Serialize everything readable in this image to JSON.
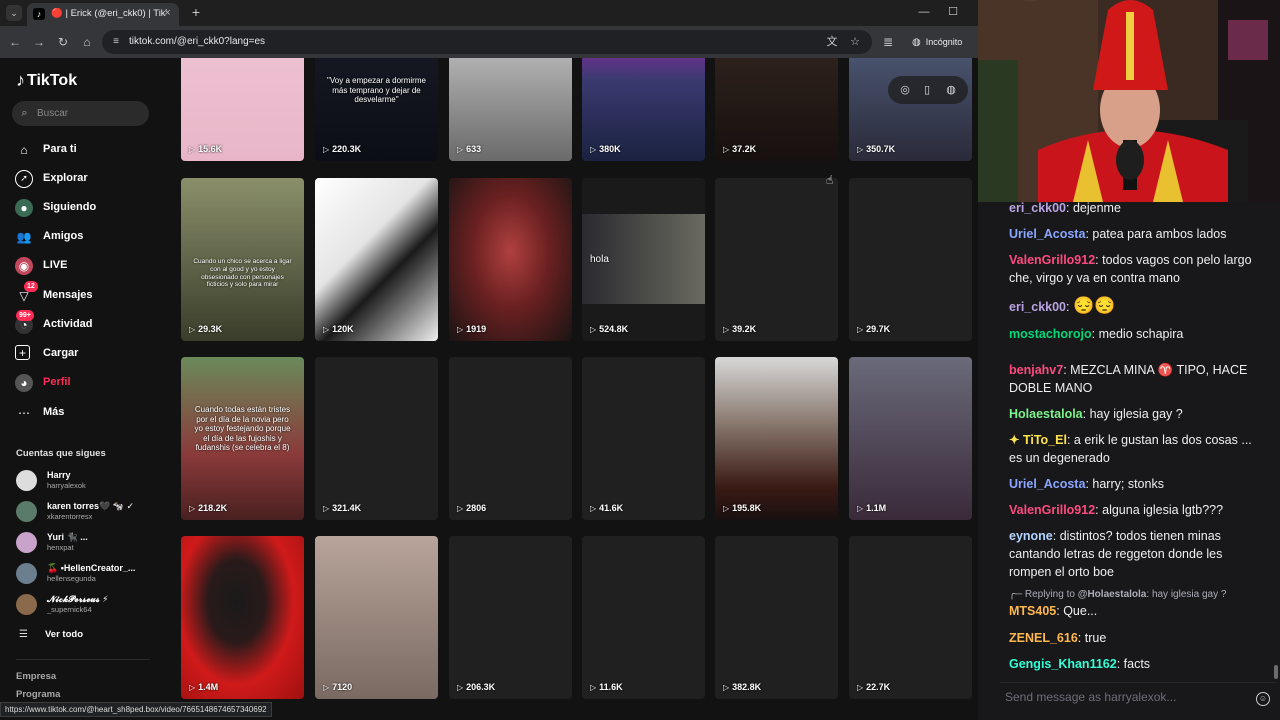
{
  "browser": {
    "tab_title": "🔴 | Erick (@eri_ckk0) | TikTok",
    "url": "tiktok.com/@eri_ckk0?lang=es",
    "incognito_label": "Incógnito",
    "status_url": "https://www.tiktok.com/@heart_sh8ped.box/video/7665148674657340692"
  },
  "sidebar": {
    "logo": "TikTok",
    "search_placeholder": "Buscar",
    "nav": [
      {
        "label": "Para ti",
        "icon": "home-icon"
      },
      {
        "label": "Explorar",
        "icon": "compass-icon"
      },
      {
        "label": "Siguiendo",
        "icon": "following-icon"
      },
      {
        "label": "Amigos",
        "icon": "friends-icon"
      },
      {
        "label": "LIVE",
        "icon": "live-icon"
      },
      {
        "label": "Mensajes",
        "icon": "messages-icon",
        "badge": "12"
      },
      {
        "label": "Actividad",
        "icon": "activity-icon",
        "badge": "99+"
      },
      {
        "label": "Cargar",
        "icon": "upload-icon"
      },
      {
        "label": "Perfil",
        "icon": "profile-icon",
        "active": true
      },
      {
        "label": "Más",
        "icon": "more-icon"
      }
    ],
    "following_title": "Cuentas que sigues",
    "following": [
      {
        "name": "Harry",
        "handle": "harryalexok"
      },
      {
        "name": "karen torres🖤 🐄 ✓",
        "handle": "xkarentorresx"
      },
      {
        "name": "Yuri 🐈‍⬛ ...",
        "handle": "henxpat"
      },
      {
        "name": "🍒 •HellenCreator_...",
        "handle": "hellensegunda"
      },
      {
        "name": "𝓝𝓲𝓬𝓴𝓟𝓮𝓻𝓼𝓮𝓾𝓼 ⚡",
        "handle": "_supernick64"
      }
    ],
    "see_all": "Ver todo",
    "footer": [
      "Empresa",
      "Programa"
    ]
  },
  "grid": {
    "views": [
      "15.6K",
      "220.3K",
      "633",
      "380K",
      "37.2K",
      "350.7K",
      "29.3K",
      "120K",
      "1919",
      "524.8K",
      "39.2K",
      "29.7K",
      "218.2K",
      "321.4K",
      "2806",
      "41.6K",
      "195.8K",
      "1.1M",
      "1.4M",
      "7120",
      "206.3K",
      "11.6K",
      "382.8K",
      "22.7K"
    ],
    "captions": {
      "c1": "\"Voy a empezar a dormirme más temprano y dejar de desvelarme\"",
      "c6": "Cuando un chico se acerca a ligar con al good y yo estoy obsesionado con personajes ficticios y solo para mirar",
      "c9": "hola",
      "c12": "Cuando todas están tristes por el día de la novia pero yo estoy festejando porque el día de las fujoshis y fudanshis (se celebra el 8)"
    }
  },
  "chat": {
    "messages": [
      {
        "user": "eri_ckk00",
        "color": "#b9a3e3",
        "text": "dejenme"
      },
      {
        "user": "Uriel_Acosta",
        "color": "#8aa6ff",
        "text": "patea para ambos lados"
      },
      {
        "user": "ValenGrillo912",
        "color": "#ff4a80",
        "text": "todos vagos con pelo largo che, virgo y va en contra mano"
      },
      {
        "user": "eri_ckk00",
        "color": "#b9a3e3",
        "text": "😔😔"
      },
      {
        "user": "mostachorojo",
        "color": "#00d97a",
        "text": "medio schapira"
      },
      {
        "user": "benjahv7",
        "color": "#ff4a80",
        "text": "MEZCLA MINA ♈ TIPO, HACE DOBLE MANO"
      },
      {
        "user": "Holaestalola",
        "color": "#7cf28c",
        "text": "hay iglesia gay ?"
      },
      {
        "user": "✦ TiTo_El",
        "color": "#ffe34d",
        "text": "a erik le gustan las dos cosas ... es un degenerado"
      },
      {
        "user": "Uriel_Acosta",
        "color": "#8aa6ff",
        "text": "harry; stonks"
      },
      {
        "user": "ValenGrillo912",
        "color": "#ff4a80",
        "text": "alguna iglesia lgtb???"
      },
      {
        "user": "eynone",
        "color": "#b3d4ff",
        "text": "distintos? todos tienen minas cantando letras de reggeton donde les rompen el orto boe"
      },
      {
        "user": "MTS405",
        "color": "#ffb84d",
        "text": "Que...",
        "reply_to": "@Holaestalola",
        "reply_text": "hay iglesia gay ?",
        "reply_label": "Replying to"
      },
      {
        "user": "ZENEL_616",
        "color": "#ffb84d",
        "text": "true"
      },
      {
        "user": "Gengis_Khan1162",
        "color": "#33ffd6",
        "text": "facts"
      }
    ],
    "input_placeholder": "Send message as harryalexok..."
  }
}
